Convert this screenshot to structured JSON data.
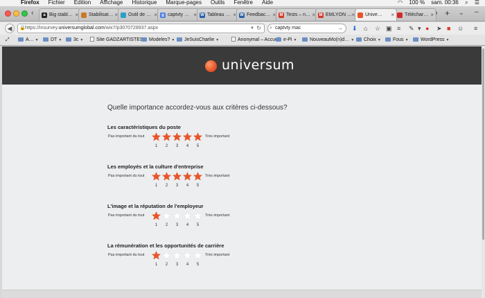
{
  "menubar": {
    "apple": "",
    "items": [
      "Firefox",
      "Fichier",
      "Édition",
      "Affichage",
      "Historique",
      "Marque-pages",
      "Outils",
      "Fenêtre",
      "Aide"
    ],
    "battery": "100 %",
    "clock": "sam. 00:36"
  },
  "tabs": [
    {
      "label": "Big stabl…",
      "fav": "a",
      "color": "#222"
    },
    {
      "label": "Stabilisat…",
      "fav": "",
      "color": "#c87a2a"
    },
    {
      "label": "Outil de …",
      "fav": "",
      "color": "#2aa0c8"
    },
    {
      "label": "captvty …",
      "fav": "g",
      "color": "#4a7be0"
    },
    {
      "label": "Tableau …",
      "fav": "W",
      "color": "#2a5fa8"
    },
    {
      "label": "Feedbac…",
      "fav": "W",
      "color": "#2a5fa8"
    },
    {
      "label": "Tests – n…",
      "fav": "M",
      "color": "#d23a2a"
    },
    {
      "label": "EMLYON …",
      "fav": "M",
      "color": "#d23a2a"
    },
    {
      "label": "Unive…",
      "fav": "",
      "color": "#e8552a"
    },
    {
      "label": "Téléchar…",
      "fav": "",
      "color": "#d22a2a"
    }
  ],
  "nav": {
    "url_prefix": "https://insurvey.",
    "url_domain": "universumglobal.com",
    "url_suffix": "/wix7/p3070728937.aspx",
    "search_value": "captvty mac"
  },
  "bookmarks": [
    {
      "label": "A…",
      "type": "folder"
    },
    {
      "label": "DT",
      "type": "folder"
    },
    {
      "label": "3c",
      "type": "folder"
    },
    {
      "label": "Site GADZARTISTES",
      "type": "page"
    },
    {
      "label": "Modeles?",
      "type": "folder"
    },
    {
      "label": "JeSuisCharlie",
      "type": "folder"
    },
    {
      "label": "Anonymal – Accueil",
      "type": "page"
    },
    {
      "label": "e-Pi",
      "type": "folder"
    },
    {
      "label": "NouveauMo(n)d…",
      "type": "folder"
    },
    {
      "label": "Choix",
      "type": "folder"
    },
    {
      "label": "Fous",
      "type": "folder"
    },
    {
      "label": "WordPress",
      "type": "folder"
    }
  ],
  "site": {
    "logo_text": "universum"
  },
  "survey": {
    "question": "Quelle importance accordez-vous aux critères ci-dessous?",
    "label_low": "Pas important du tout",
    "label_high": "Très important",
    "scale": [
      "1",
      "2",
      "3",
      "4",
      "5"
    ],
    "criteria": [
      {
        "title": "Les caractéristiques du poste",
        "rating": 5
      },
      {
        "title": "Les employés et la culture d'entreprise",
        "rating": 5
      },
      {
        "title": "L'image et la réputation de l'employeur",
        "rating": 1
      },
      {
        "title": "La rémunération et les opportunités de carrière",
        "rating": 1
      }
    ]
  },
  "colors": {
    "accent": "#e8552a",
    "star_empty": "#ffffff",
    "header_bg": "#3a3a3a"
  }
}
